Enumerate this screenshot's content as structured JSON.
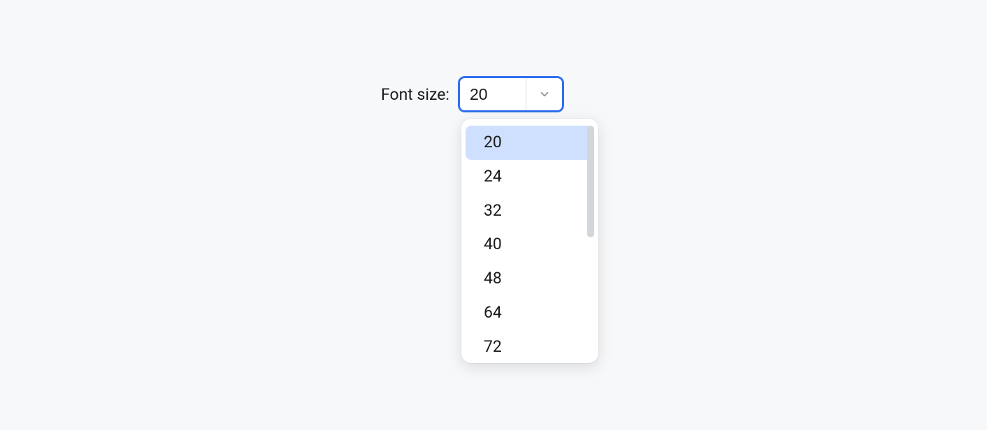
{
  "fontSize": {
    "label": "Font size:",
    "value": "20",
    "selectedIndex": 0,
    "options": [
      "20",
      "24",
      "32",
      "40",
      "48",
      "64",
      "72"
    ]
  }
}
